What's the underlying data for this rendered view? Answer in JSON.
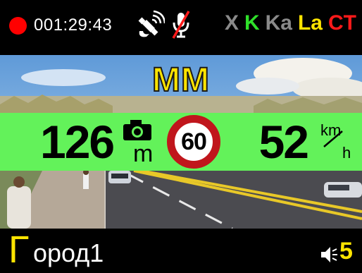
{
  "status_bar": {
    "recording_color": "#ff0000",
    "recording_time": "001:29:43",
    "gps_icon": "satellite-gps-icon",
    "mic_icon": "microphone-muted-icon",
    "bands": [
      {
        "label": "X",
        "color": "#8a8a8a"
      },
      {
        "label": "K",
        "color": "#2fe02a"
      },
      {
        "label": "Ka",
        "color": "#8a8a8a"
      },
      {
        "label": "La",
        "color": "#ffe400"
      },
      {
        "label": "CT",
        "color": "#ff1a1a"
      }
    ]
  },
  "camera_type": "MM",
  "info_band": {
    "distance": "126",
    "distance_unit": "m",
    "camera_icon": "speed-camera-icon",
    "speed_limit": "60",
    "current_speed": "52",
    "speed_unit_top": "km",
    "speed_unit_bottom": "h",
    "band_color": "#63f25a"
  },
  "bottom_bar": {
    "mode_first_letter": "Г",
    "mode_rest": "ород1",
    "volume_icon": "speaker-volume-icon",
    "volume": "5"
  }
}
